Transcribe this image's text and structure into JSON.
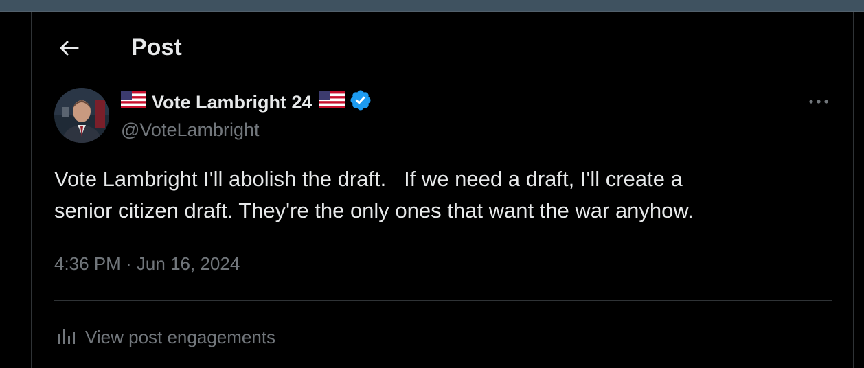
{
  "header": {
    "title": "Post",
    "back_icon": "back-arrow-icon"
  },
  "post": {
    "display_name": "Vote Lambright 24",
    "flag_icon": "us-flag-icon",
    "verified_icon": "verified-badge-icon",
    "verified_color": "#1d9bf0",
    "handle": "@VoteLambright",
    "text": "Vote Lambright I'll abolish the draft.   If we need a draft, I'll create a\nsenior citizen draft. They're the only ones that want the war anyhow.",
    "timestamp": "4:36 PM · Jun 16, 2024",
    "more_icon": "more-options-icon"
  },
  "footer": {
    "engagements_label": "View post engagements",
    "engagements_icon": "analytics-bars-icon"
  },
  "colors": {
    "background": "#000000",
    "primary_text": "#e7e9ea",
    "secondary_text": "#71767b",
    "divider": "#2f3336"
  }
}
